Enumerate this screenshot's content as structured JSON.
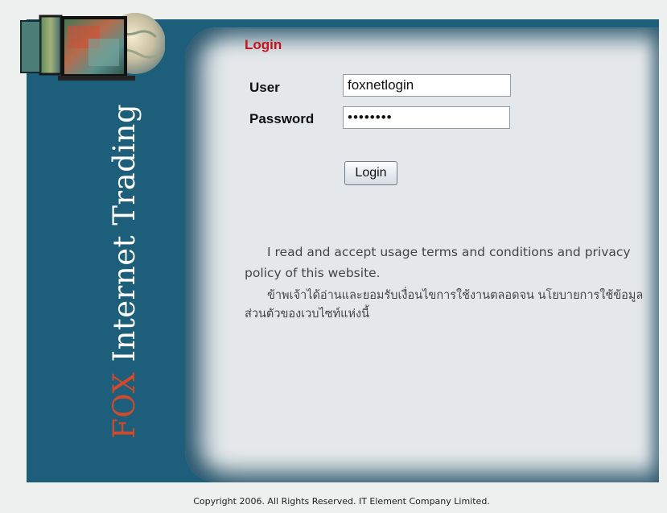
{
  "brand": {
    "prefix": "FOX",
    "rest": " Internet Trading"
  },
  "login": {
    "title": "Login",
    "user_label": "User",
    "user_value": "foxnetlogin",
    "password_label": "Password",
    "password_value": "password",
    "button_label": "Login"
  },
  "terms": {
    "english": "I read and accept usage terms and conditions and privacy policy of this website.",
    "thai": "ข้าพเจ้าได้อ่านและยอมรับเงื่อนไขการใช้งานตลอดจน นโยบายการใช้ข้อมูล ส่วนตัวของเวบไซท์แห่งนี้"
  },
  "footer": {
    "copyright": "Copyright 2006. All Rights Reserved. IT Element Company Limited."
  },
  "colors": {
    "frame": "#1d5f7a",
    "title_red": "#c8121a",
    "brand_red": "#d24a2a",
    "panel": "#e4e8ea"
  }
}
